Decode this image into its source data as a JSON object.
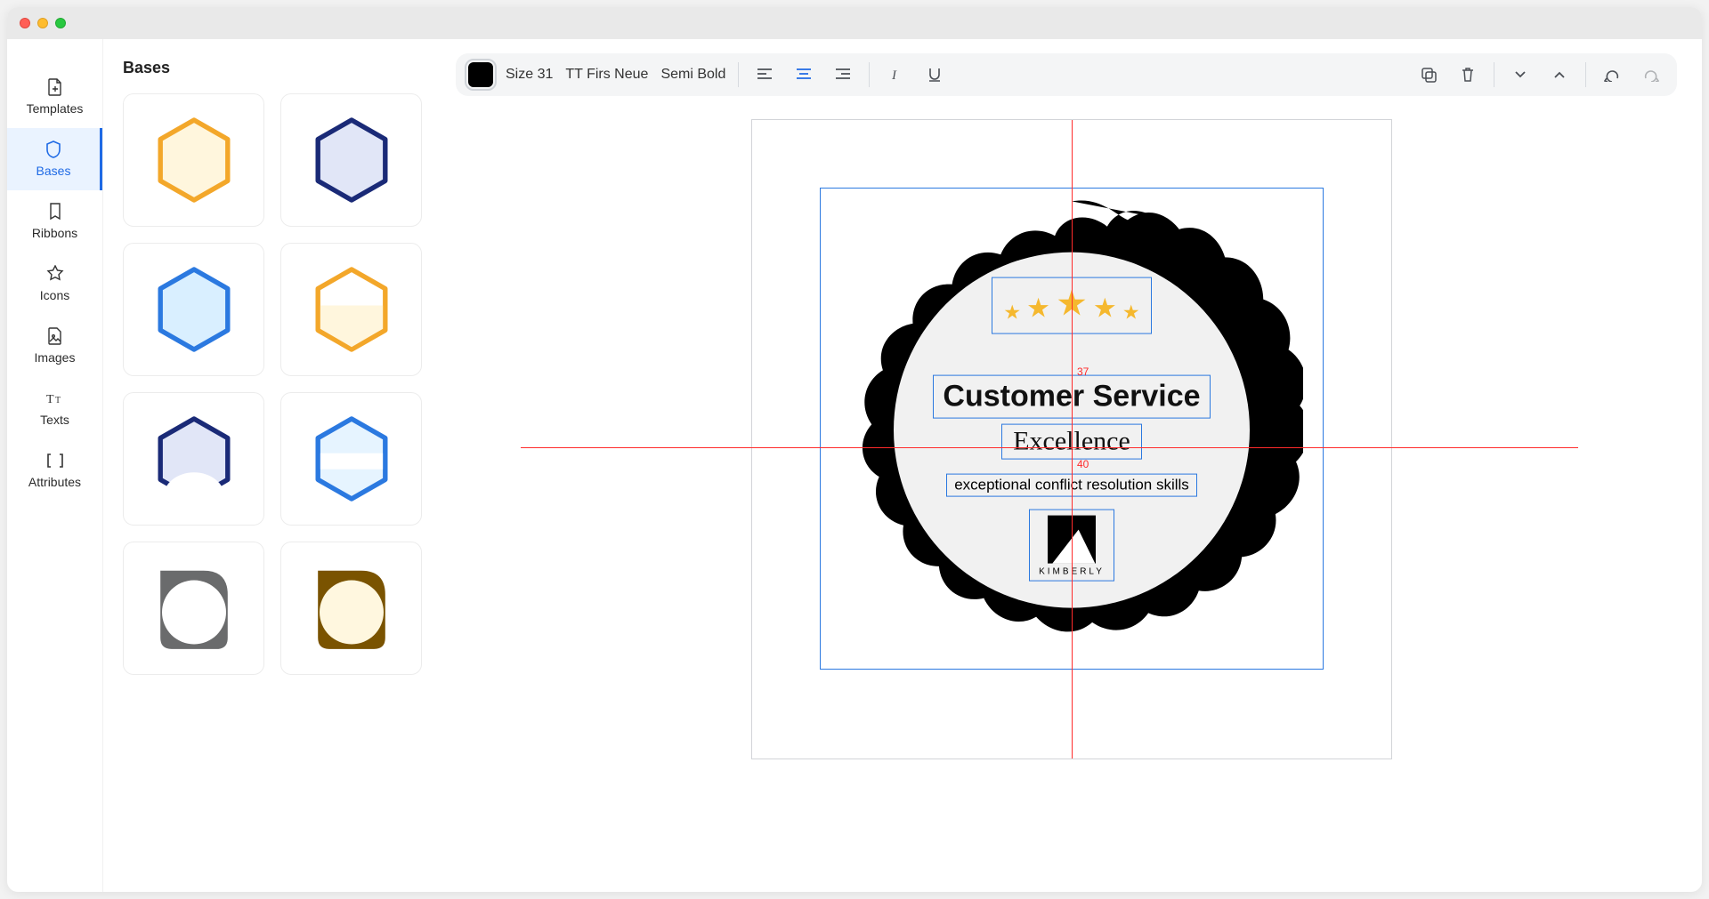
{
  "sidebar": {
    "items": [
      {
        "label": "Templates"
      },
      {
        "label": "Bases"
      },
      {
        "label": "Ribbons"
      },
      {
        "label": "Icons"
      },
      {
        "label": "Images"
      },
      {
        "label": "Texts"
      },
      {
        "label": "Attributes"
      }
    ],
    "active_index": 1
  },
  "panel": {
    "title": "Bases"
  },
  "toolbar": {
    "size_label": "Size 31",
    "font_label": "TT Firs Neue",
    "weight_label": "Semi Bold",
    "color": "#000000"
  },
  "canvas": {
    "badge": {
      "title": "Customer Service",
      "subtitle": "Excellence",
      "description": "exceptional conflict resolution skills",
      "brand": "KIMBERLY"
    },
    "measurements": {
      "gap1": "37",
      "gap2": "40"
    }
  }
}
